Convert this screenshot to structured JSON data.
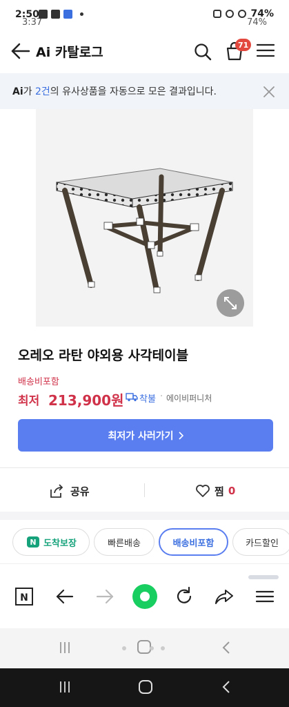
{
  "status": {
    "time": "2:50",
    "time_ghost": "3:37",
    "battery": "74%",
    "battery_ghost": "74%"
  },
  "header": {
    "title": "Ai 카탈로그",
    "cart_count": "71",
    "icons": [
      "back-icon",
      "search-icon",
      "cart-icon",
      "menu-icon"
    ]
  },
  "notice": {
    "prefix": "Ai",
    "text_a": "가 ",
    "count": "2건",
    "text_b": "의 유사상품을 자동으로 모은 결과입니다."
  },
  "product": {
    "title": "오레오 라탄 야외용 사각테이블",
    "shipping_tag": "배송비포함",
    "price_label": "최저",
    "price": "213,900원",
    "delivery_label": "착불",
    "separator": "·",
    "seller": "에이비퍼니처",
    "buy_label": "최저가 사러가기"
  },
  "actions": {
    "share_label": "공유",
    "like_label": "찜",
    "like_count": "0"
  },
  "filters": {
    "chips": [
      {
        "label": "도착보장",
        "active": false
      },
      {
        "label": "빠른배송",
        "active": false
      },
      {
        "label": "배송비포함",
        "active": true
      },
      {
        "label": "카드할인",
        "active": false
      }
    ]
  },
  "colors": {
    "accent_blue": "#5a7ef0",
    "price_red": "#d0324a",
    "arrival_green": "#16a37b",
    "badge_red": "#e2483d"
  }
}
